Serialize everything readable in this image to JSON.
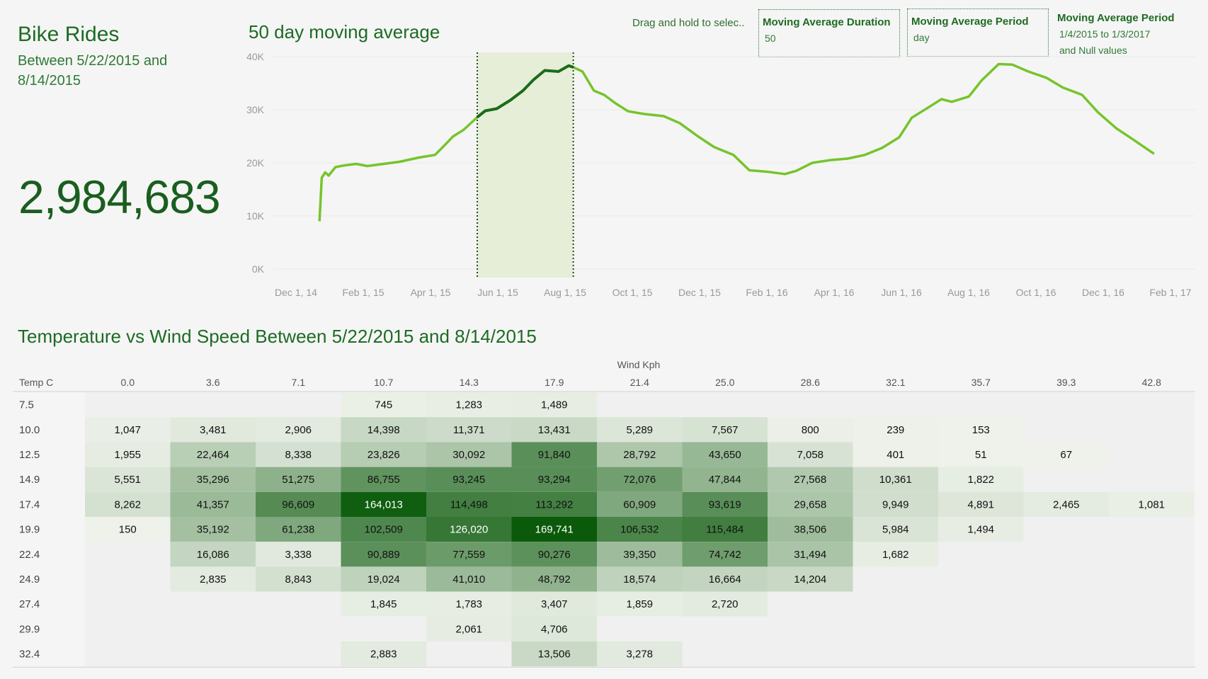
{
  "kpi": {
    "title": "Bike Rides",
    "subtitle": "Between 5/22/2015 and 8/14/2015",
    "value": "2,984,683"
  },
  "moving_average": {
    "title": "50 day moving average",
    "drag_hint": "Drag and hold to selec..",
    "duration_param": {
      "label": "Moving Average Duration",
      "value": "50"
    },
    "period_param": {
      "label": "Moving Average Period",
      "value": "day"
    },
    "period_filter": {
      "label": "Moving Average Period",
      "value_line1": "1/4/2015 to 1/3/2017",
      "value_line2": "and Null values"
    }
  },
  "heatmap_title": "Temperature vs Wind Speed Between 5/22/2015 and 8/14/2015",
  "colors": {
    "line": "#76c42b",
    "line_selected": "#1b6b1b",
    "selection_band": "#e6eed7",
    "heat_max": "#0b5a0b",
    "heat_min": "#f0f3ec",
    "title": "#1e6b23"
  },
  "chart_data": [
    {
      "type": "line",
      "title": "50 day moving average",
      "x_tick_labels": [
        "Dec 1, 14",
        "Feb 1, 15",
        "Apr 1, 15",
        "Jun 1, 15",
        "Aug 1, 15",
        "Oct 1, 15",
        "Dec 1, 15",
        "Feb 1, 16",
        "Apr 1, 16",
        "Jun 1, 16",
        "Aug 1, 16",
        "Oct 1, 16",
        "Dec 1, 16",
        "Feb 1, 17"
      ],
      "x_range": [
        "2014-11-24",
        "2017-02-08"
      ],
      "y_tick_labels": [
        "0K",
        "10K",
        "20K",
        "30K",
        "40K"
      ],
      "ylim": [
        0,
        40000
      ],
      "selection": {
        "start": "2015-05-22",
        "end": "2015-08-14"
      },
      "points": [
        [
          "2015-01-04",
          9000
        ],
        [
          "2015-01-06",
          17200
        ],
        [
          "2015-01-09",
          18200
        ],
        [
          "2015-01-12",
          17600
        ],
        [
          "2015-01-18",
          19200
        ],
        [
          "2015-01-25",
          19500
        ],
        [
          "2015-02-05",
          19800
        ],
        [
          "2015-02-15",
          19400
        ],
        [
          "2015-03-01",
          19800
        ],
        [
          "2015-03-15",
          20200
        ],
        [
          "2015-04-01",
          21000
        ],
        [
          "2015-04-15",
          21500
        ],
        [
          "2015-04-22",
          23000
        ],
        [
          "2015-05-01",
          25000
        ],
        [
          "2015-05-10",
          26200
        ],
        [
          "2015-05-22",
          28600
        ],
        [
          "2015-05-29",
          29800
        ],
        [
          "2015-06-08",
          30200
        ],
        [
          "2015-06-20",
          31800
        ],
        [
          "2015-07-01",
          33600
        ],
        [
          "2015-07-10",
          35600
        ],
        [
          "2015-07-20",
          37400
        ],
        [
          "2015-08-01",
          37200
        ],
        [
          "2015-08-10",
          38300
        ],
        [
          "2015-08-14",
          38000
        ],
        [
          "2015-08-22",
          37200
        ],
        [
          "2015-09-01",
          33600
        ],
        [
          "2015-09-10",
          32800
        ],
        [
          "2015-09-20",
          31200
        ],
        [
          "2015-10-01",
          29700
        ],
        [
          "2015-10-15",
          29200
        ],
        [
          "2015-11-01",
          28800
        ],
        [
          "2015-11-15",
          27500
        ],
        [
          "2015-12-01",
          25000
        ],
        [
          "2015-12-15",
          23000
        ],
        [
          "2016-01-01",
          21500
        ],
        [
          "2016-01-15",
          18600
        ],
        [
          "2016-02-01",
          18300
        ],
        [
          "2016-02-15",
          17900
        ],
        [
          "2016-02-25",
          18500
        ],
        [
          "2016-03-10",
          20000
        ],
        [
          "2016-03-25",
          20500
        ],
        [
          "2016-04-10",
          20800
        ],
        [
          "2016-04-25",
          21500
        ],
        [
          "2016-05-10",
          22800
        ],
        [
          "2016-05-25",
          24800
        ],
        [
          "2016-06-05",
          28500
        ],
        [
          "2016-06-20",
          30500
        ],
        [
          "2016-07-01",
          32000
        ],
        [
          "2016-07-10",
          31500
        ],
        [
          "2016-07-25",
          32500
        ],
        [
          "2016-08-05",
          35500
        ],
        [
          "2016-08-20",
          38600
        ],
        [
          "2016-09-01",
          38500
        ],
        [
          "2016-09-15",
          37200
        ],
        [
          "2016-10-01",
          36000
        ],
        [
          "2016-10-15",
          34200
        ],
        [
          "2016-11-01",
          32800
        ],
        [
          "2016-11-15",
          29500
        ],
        [
          "2016-12-01",
          26500
        ],
        [
          "2016-12-15",
          24500
        ],
        [
          "2017-01-03",
          21700
        ]
      ]
    },
    {
      "type": "heatmap",
      "title": "Temperature vs Wind Speed Between 5/22/2015 and 8/14/2015",
      "column_axis_label": "Wind Kph",
      "row_axis_label": "Temp C",
      "columns": [
        "0.0",
        "3.6",
        "7.1",
        "10.7",
        "14.3",
        "17.9",
        "21.4",
        "25.0",
        "28.6",
        "32.1",
        "35.7",
        "39.3",
        "42.8"
      ],
      "rows": [
        {
          "label": "7.5",
          "values": [
            null,
            null,
            null,
            745,
            1283,
            1489,
            null,
            null,
            null,
            null,
            null,
            null,
            null
          ],
          "text": [
            "",
            "",
            "",
            "745",
            "1,283",
            "1,489",
            "",
            "",
            "",
            "",
            "",
            "",
            ""
          ]
        },
        {
          "label": "10.0",
          "values": [
            1047,
            3481,
            2906,
            14398,
            11371,
            13431,
            5289,
            7567,
            800,
            239,
            153,
            null,
            null
          ],
          "text": [
            "1,047",
            "3,481",
            "2,906",
            "14,398",
            "11,371",
            "13,431",
            "5,289",
            "7,567",
            "800",
            "239",
            "153",
            "",
            ""
          ]
        },
        {
          "label": "12.5",
          "values": [
            1955,
            22464,
            8338,
            23826,
            30092,
            91840,
            28792,
            43650,
            7058,
            401,
            51,
            67,
            null
          ],
          "text": [
            "1,955",
            "22,464",
            "8,338",
            "23,826",
            "30,092",
            "91,840",
            "28,792",
            "43,650",
            "7,058",
            "401",
            "51",
            "67",
            ""
          ]
        },
        {
          "label": "14.9",
          "values": [
            5551,
            35296,
            51275,
            86755,
            93245,
            93294,
            72076,
            47844,
            27568,
            10361,
            1822,
            null,
            null
          ],
          "text": [
            "5,551",
            "35,296",
            "51,275",
            "86,755",
            "93,245",
            "93,294",
            "72,076",
            "47,844",
            "27,568",
            "10,361",
            "1,822",
            "",
            ""
          ]
        },
        {
          "label": "17.4",
          "values": [
            8262,
            41357,
            96609,
            164013,
            114498,
            113292,
            60909,
            93619,
            29658,
            9949,
            4891,
            2465,
            1081
          ],
          "text": [
            "8,262",
            "41,357",
            "96,609",
            "164,013",
            "114,498",
            "113,292",
            "60,909",
            "93,619",
            "29,658",
            "9,949",
            "4,891",
            "2,465",
            "1,081"
          ]
        },
        {
          "label": "19.9",
          "values": [
            150,
            35192,
            61238,
            102509,
            126020,
            169741,
            106532,
            115484,
            38506,
            5984,
            1494,
            null,
            null
          ],
          "text": [
            "150",
            "35,192",
            "61,238",
            "102,509",
            "126,020",
            "169,741",
            "106,532",
            "115,484",
            "38,506",
            "5,984",
            "1,494",
            "",
            ""
          ]
        },
        {
          "label": "22.4",
          "values": [
            null,
            16086,
            3338,
            90889,
            77559,
            90276,
            39350,
            74742,
            31494,
            1682,
            null,
            null,
            null
          ],
          "text": [
            "",
            "16,086",
            "3,338",
            "90,889",
            "77,559",
            "90,276",
            "39,350",
            "74,742",
            "31,494",
            "1,682",
            "",
            "",
            ""
          ]
        },
        {
          "label": "24.9",
          "values": [
            null,
            2835,
            8843,
            19024,
            41010,
            48792,
            18574,
            16664,
            14204,
            null,
            null,
            null,
            null
          ],
          "text": [
            "",
            "2,835",
            "8,843",
            "19,024",
            "41,010",
            "48,792",
            "18,574",
            "16,664",
            "14,204",
            "",
            "",
            "",
            ""
          ]
        },
        {
          "label": "27.4",
          "values": [
            null,
            null,
            null,
            1845,
            1783,
            3407,
            1859,
            2720,
            null,
            null,
            null,
            null,
            null
          ],
          "text": [
            "",
            "",
            "",
            "1,845",
            "1,783",
            "3,407",
            "1,859",
            "2,720",
            "",
            "",
            "",
            "",
            ""
          ]
        },
        {
          "label": "29.9",
          "values": [
            null,
            null,
            null,
            null,
            2061,
            4706,
            null,
            null,
            null,
            null,
            null,
            null,
            null
          ],
          "text": [
            "",
            "",
            "",
            "",
            "2,061",
            "4,706",
            "",
            "",
            "",
            "",
            "",
            "",
            ""
          ]
        },
        {
          "label": "32.4",
          "values": [
            null,
            null,
            null,
            2883,
            null,
            13506,
            3278,
            null,
            null,
            null,
            null,
            null,
            null
          ],
          "text": [
            "",
            "",
            "",
            "2,883",
            "",
            "13,506",
            "3,278",
            "",
            "",
            "",
            "",
            "",
            ""
          ]
        }
      ]
    }
  ]
}
